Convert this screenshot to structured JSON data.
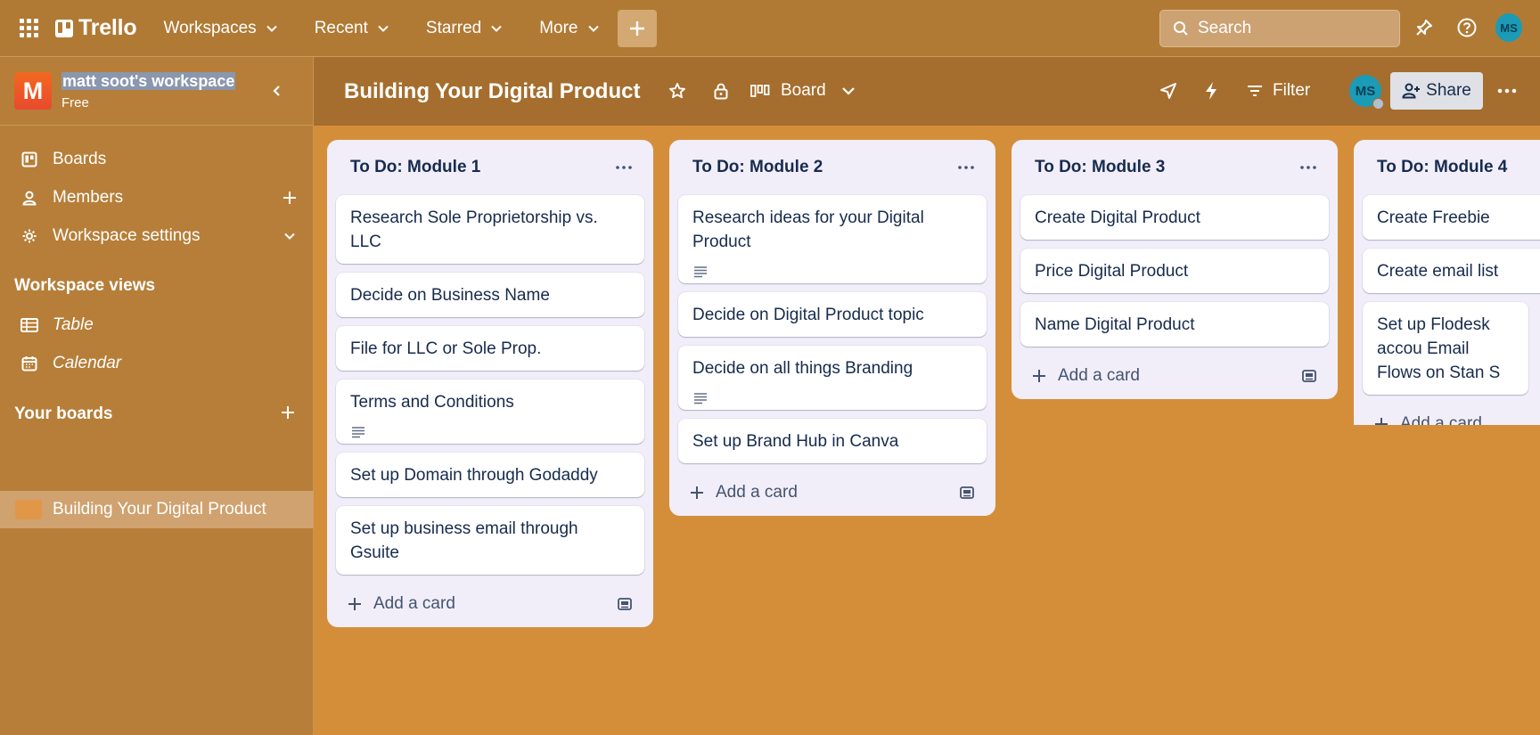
{
  "topnav": {
    "brand": "Trello",
    "menu": [
      {
        "label": "Workspaces"
      },
      {
        "label": "Recent"
      },
      {
        "label": "Starred"
      },
      {
        "label": "More"
      }
    ],
    "search_placeholder": "Search",
    "user_initials": "MS"
  },
  "sidebar": {
    "workspace_initial": "M",
    "workspace_name": "matt soot's workspace",
    "workspace_plan": "Free",
    "items": [
      {
        "label": "Boards",
        "icon": "board-icon"
      },
      {
        "label": "Members",
        "icon": "person-icon"
      },
      {
        "label": "Workspace settings",
        "icon": "gear-icon"
      }
    ],
    "views_heading": "Workspace views",
    "views": [
      {
        "label": "Table",
        "icon": "table-icon"
      },
      {
        "label": "Calendar",
        "icon": "calendar-icon"
      }
    ],
    "boards_heading": "Your boards",
    "boards": [
      {
        "label": "Building Your Digital Product",
        "color": "#e29748"
      }
    ]
  },
  "board": {
    "title": "Building Your Digital Product",
    "view": "Board",
    "filter_label": "Filter",
    "member_initials": "MS",
    "share_label": "Share",
    "background_color": "#d48e3a"
  },
  "lists": [
    {
      "title": "To Do: Module 1",
      "cards": [
        {
          "text": "Research Sole Proprietorship vs. LLC",
          "has_description": false
        },
        {
          "text": "Decide on Business Name",
          "has_description": false
        },
        {
          "text": "File for LLC or Sole Prop.",
          "has_description": false
        },
        {
          "text": "Terms and Conditions",
          "has_description": true
        },
        {
          "text": "Set up Domain through Godaddy",
          "has_description": false
        },
        {
          "text": "Set up business email through Gsuite",
          "has_description": false
        }
      ],
      "add_label": "Add a card"
    },
    {
      "title": "To Do: Module 2",
      "cards": [
        {
          "text": "Research ideas for your Digital Product",
          "has_description": true
        },
        {
          "text": "Decide on Digital Product topic",
          "has_description": false
        },
        {
          "text": "Decide on all things Branding",
          "has_description": true
        },
        {
          "text": "Set up Brand Hub in Canva",
          "has_description": false
        }
      ],
      "add_label": "Add a card"
    },
    {
      "title": "To Do: Module 3",
      "cards": [
        {
          "text": "Create Digital Product",
          "has_description": false
        },
        {
          "text": "Price Digital Product",
          "has_description": false
        },
        {
          "text": "Name Digital Product",
          "has_description": false
        }
      ],
      "add_label": "Add a card"
    },
    {
      "title": "To Do: Module 4",
      "cards": [
        {
          "text": "Create Freebie",
          "has_description": false
        },
        {
          "text": "Create email list",
          "has_description": false
        },
        {
          "text": "Set up Flodesk accou Email Flows on Stan S",
          "has_description": false
        }
      ],
      "add_label": "Add a card"
    }
  ]
}
